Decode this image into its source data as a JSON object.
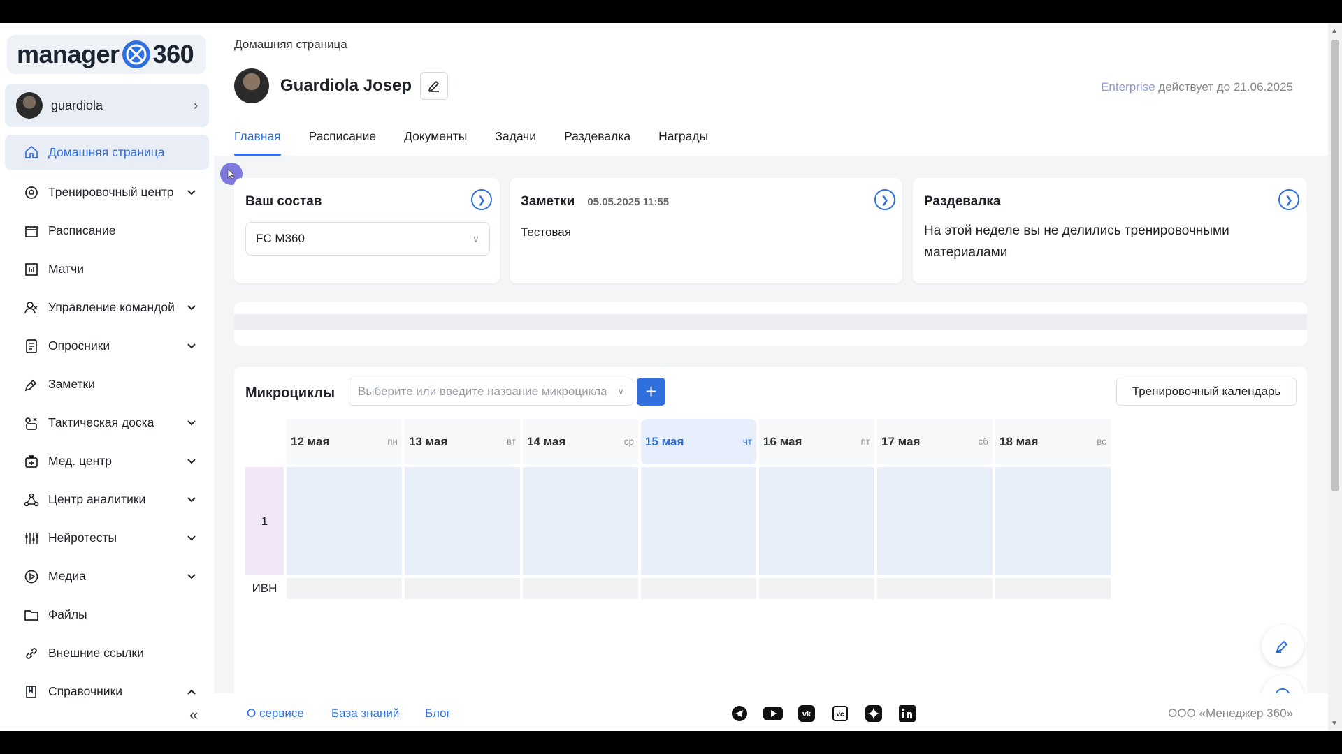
{
  "logo": {
    "text_left": "manager",
    "text_right": "360"
  },
  "user": {
    "name": "guardiola"
  },
  "sidebar": {
    "items": [
      {
        "label": "Домашняя страница",
        "icon": "home-icon",
        "active": true,
        "chevron": ""
      },
      {
        "label": "Тренировочный центр",
        "icon": "training-ball-icon",
        "chevron": "down"
      },
      {
        "label": "Расписание",
        "icon": "calendar-icon",
        "chevron": ""
      },
      {
        "label": "Матчи",
        "icon": "matches-icon",
        "chevron": ""
      },
      {
        "label": "Управление командой",
        "icon": "team-icon",
        "chevron": "down"
      },
      {
        "label": "Опросники",
        "icon": "survey-icon",
        "chevron": "down"
      },
      {
        "label": "Заметки",
        "icon": "pen-icon",
        "chevron": ""
      },
      {
        "label": "Тактическая доска",
        "icon": "tactics-icon",
        "chevron": "down"
      },
      {
        "label": "Мед. центр",
        "icon": "medical-icon",
        "chevron": "down"
      },
      {
        "label": "Центр аналитики",
        "icon": "analytics-icon",
        "chevron": "down"
      },
      {
        "label": "Нейротесты",
        "icon": "neurotest-icon",
        "chevron": "down"
      },
      {
        "label": "Медиа",
        "icon": "play-icon",
        "chevron": "down"
      },
      {
        "label": "Файлы",
        "icon": "folder-icon",
        "chevron": ""
      },
      {
        "label": "Внешние ссылки",
        "icon": "link-icon",
        "chevron": ""
      },
      {
        "label": "Справочники",
        "icon": "book-icon",
        "chevron": "up"
      }
    ]
  },
  "header": {
    "breadcrumb": "Домашняя страница",
    "profile_name": "Guardiola Josep",
    "license_plan": "Enterprise",
    "license_text": " действует до 21.06.2025",
    "tabs": [
      "Главная",
      "Расписание",
      "Документы",
      "Задачи",
      "Раздевалка",
      "Награды"
    ]
  },
  "cards": {
    "squad": {
      "title": "Ваш состав",
      "selected": "FC M360"
    },
    "notes": {
      "title": "Заметки",
      "date": "05.05.2025 11:55",
      "text": "Тестовая"
    },
    "locker": {
      "title": "Раздевалка",
      "text": "На этой неделе вы не делились тренировочными материалами"
    }
  },
  "microcycles": {
    "title": "Микроциклы",
    "placeholder": "Выберите или введите название микроцикла",
    "calendar_button": "Тренировочный календарь",
    "days": [
      {
        "date": "12 мая",
        "dow": "пн",
        "today": false
      },
      {
        "date": "13 мая",
        "dow": "вт",
        "today": false
      },
      {
        "date": "14 мая",
        "dow": "ср",
        "today": false
      },
      {
        "date": "15 мая",
        "dow": "чт",
        "today": true
      },
      {
        "date": "16 мая",
        "dow": "пт",
        "today": false
      },
      {
        "date": "17 мая",
        "dow": "сб",
        "today": false
      },
      {
        "date": "18 мая",
        "dow": "вс",
        "today": false
      }
    ],
    "row_label": "1",
    "ivn_label": "ИВН"
  },
  "footer": {
    "links": [
      "О сервисе",
      "База знаний",
      "Блог"
    ],
    "social": [
      "telegram-icon",
      "youtube-icon",
      "vk-icon",
      "vc-icon",
      "dzen-icon",
      "linkedin-icon"
    ],
    "company": "ООО «Менеджер 360»"
  },
  "colors": {
    "accent": "#2f6fde",
    "active_bg": "#e9eef6",
    "today_bg": "#e7eefc",
    "cell_bg": "#e8eef9",
    "row_label_bg": "#f2e7f7"
  }
}
